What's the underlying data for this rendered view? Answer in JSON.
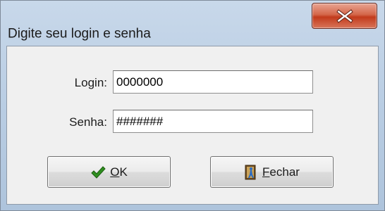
{
  "window": {
    "title": "Digite seu login e senha",
    "close_icon": "close-x-icon"
  },
  "form": {
    "login_label": "Login:",
    "login_value": "0000000",
    "password_label": "Senha:",
    "password_value": "#######"
  },
  "buttons": {
    "ok": {
      "accel": "O",
      "rest": "K",
      "icon": "checkmark-icon"
    },
    "close": {
      "accel": "F",
      "rest": "echar",
      "icon": "door-exit-icon"
    }
  },
  "colors": {
    "close_button": "#c94a2c",
    "check_icon": "#2f8f1f",
    "door_icon": "#6b4a1f"
  }
}
